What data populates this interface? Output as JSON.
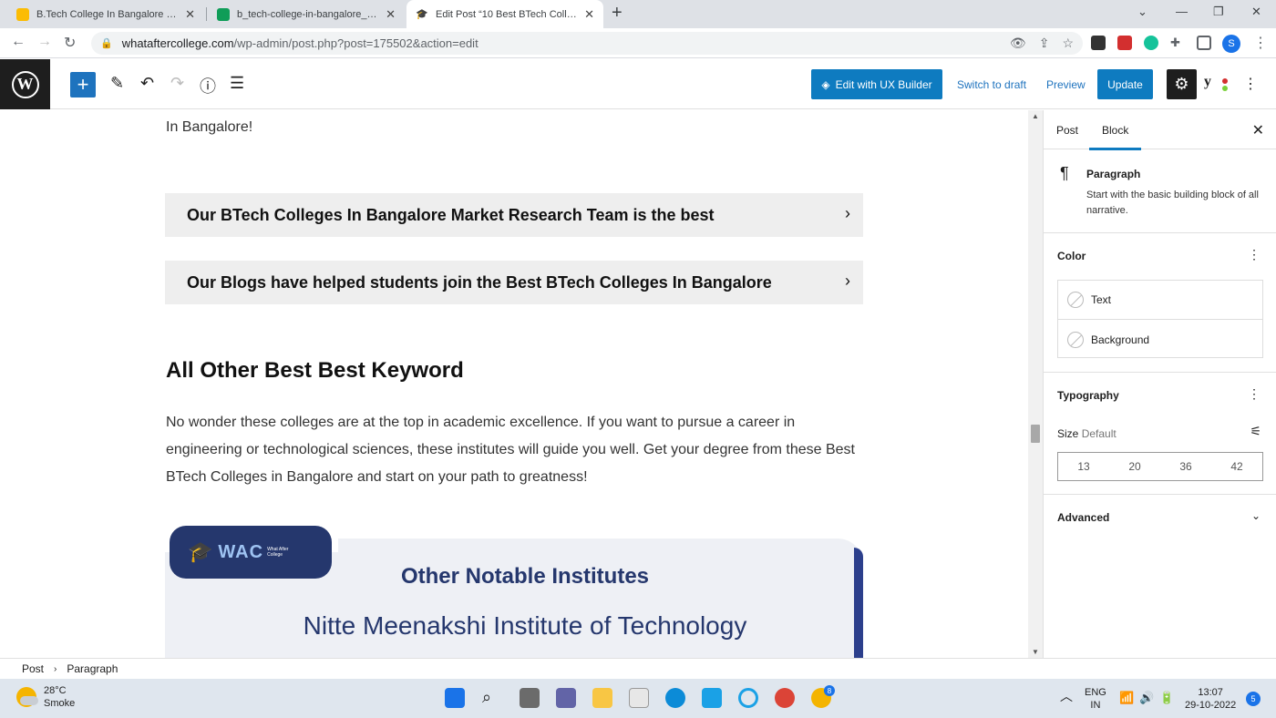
{
  "browser": {
    "tabs": [
      {
        "title": "B.Tech College In Bangalore - Go",
        "favicon_color": "#1a73e8"
      },
      {
        "title": "b_tech-college-in-bangalore_bro",
        "favicon_color": "#0f9d58"
      },
      {
        "title": "Edit Post “10 Best BTech Colleges",
        "favicon_color": "#333333"
      }
    ],
    "url_domain": "whataftercollege.com",
    "url_path": "/wp-admin/post.php?post=175502&action=edit",
    "profile_initial": "S"
  },
  "toolbar": {
    "ux_builder": "Edit with UX Builder",
    "switch_draft": "Switch to draft",
    "preview": "Preview",
    "update": "Update"
  },
  "content": {
    "top_fragment": "In Bangalore!",
    "accordions": [
      "Our BTech  Colleges In Bangalore Market Research Team is the best",
      "Our Blogs have helped students join the Best BTech  Colleges In Bangalore"
    ],
    "heading": "All Other Best Best Keyword",
    "paragraph": "No wonder these colleges are at the top in academic excellence. If you want to pursue a career in engineering or technological sciences, these institutes will guide you well. Get your degree from these Best BTech Colleges in Bangalore and start on your path to greatness!",
    "banner": {
      "logo": "WAC",
      "logo_sub": "What After College",
      "title": "Other Notable Institutes",
      "subtitle": "Nitte Meenakshi Institute of Technology"
    }
  },
  "sidebar": {
    "tabs": [
      "Post",
      "Block"
    ],
    "block": {
      "name": "Paragraph",
      "description": "Start with the basic building block of all narrative."
    },
    "color": {
      "title": "Color",
      "options": [
        "Text",
        "Background"
      ]
    },
    "typography": {
      "title": "Typography",
      "size_label": "Size",
      "size_value": "Default",
      "sizes": [
        "13",
        "20",
        "36",
        "42"
      ]
    },
    "advanced": "Advanced"
  },
  "breadcrumb": [
    "Post",
    "Paragraph"
  ],
  "taskbar": {
    "temperature": "28°C",
    "weather": "Smoke",
    "lang": "ENG",
    "region": "IN",
    "time": "13:07",
    "date": "29-10-2022",
    "notifications": "5",
    "chrome_badge": "8"
  }
}
